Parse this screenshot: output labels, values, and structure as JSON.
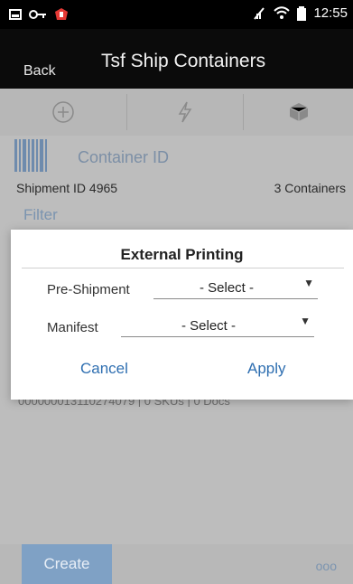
{
  "status_bar": {
    "time": "12:55"
  },
  "header": {
    "back_label": "Back",
    "title": "Tsf Ship Containers"
  },
  "toolbar": {
    "buttons": [
      {
        "icon": "plus-circle-icon"
      },
      {
        "icon": "lightning-icon"
      },
      {
        "icon": "cube-icon"
      }
    ]
  },
  "search": {
    "label": "Container ID",
    "icon": "barcode-icon"
  },
  "shipment": {
    "id_text": "Shipment ID 4965",
    "count_text": "3 Containers"
  },
  "filter": {
    "label": "Filter"
  },
  "list": {
    "ghost_text": "000000013110274079 | 0 SKUs | 0 Docs"
  },
  "footer": {
    "create_label": "Create",
    "more_label": "ooo"
  },
  "dialog": {
    "title": "External Printing",
    "fields": [
      {
        "label": "Pre-Shipment",
        "value": "- Select -"
      },
      {
        "label": "Manifest",
        "value": "- Select -"
      }
    ],
    "cancel_label": "Cancel",
    "apply_label": "Apply"
  },
  "colors": {
    "primary": "#2f6fb1",
    "dim_overlay": "#bdbdbd",
    "header_bg": "#0b0b0b"
  }
}
